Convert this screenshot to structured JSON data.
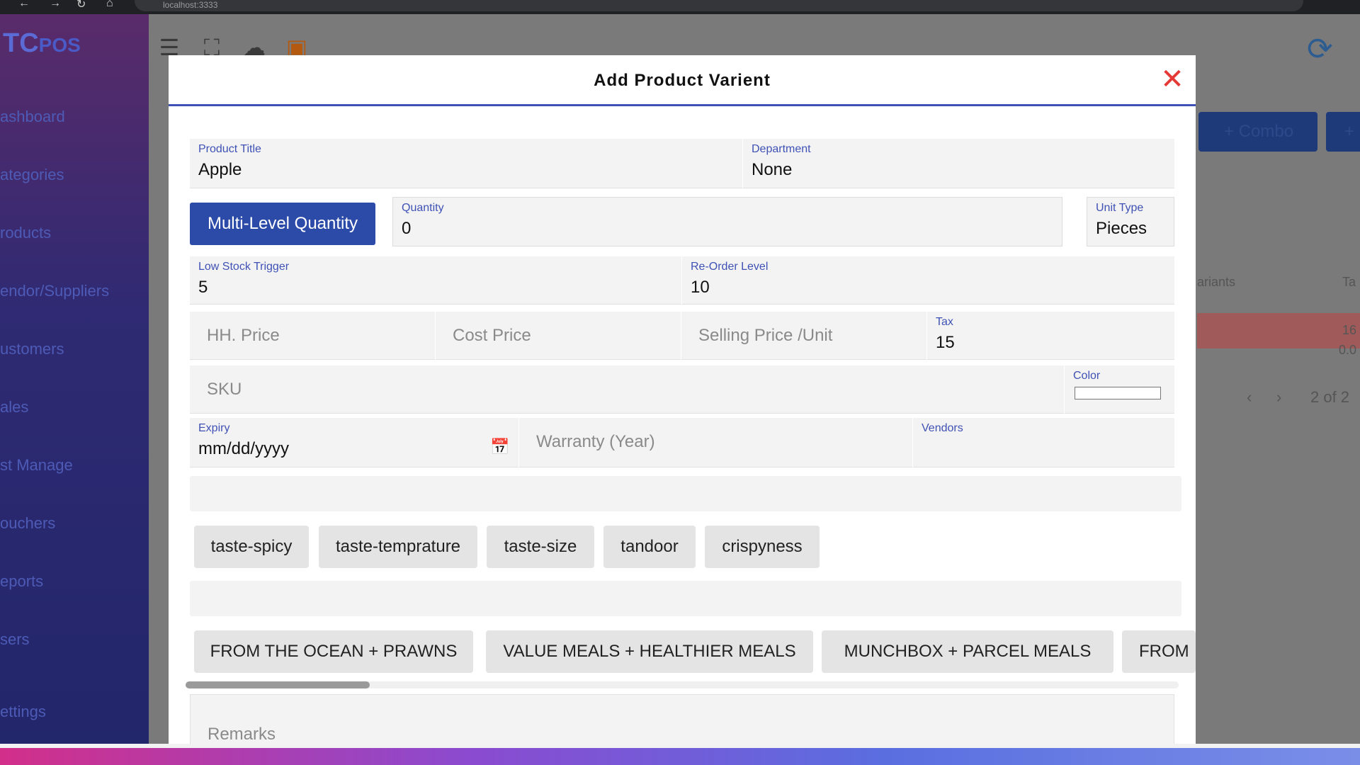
{
  "browser": {
    "url": "localhost:3333",
    "nav_back": "←",
    "nav_forward": "→",
    "nav_reload": "↻",
    "nav_home": "⌂"
  },
  "background": {
    "logo_main": "TC",
    "logo_sub": "POS",
    "sidebar_items": [
      "ashboard",
      "ategories",
      "roducts",
      "endor/Suppliers",
      "ustomers",
      "ales",
      "st Manage",
      "ouchers",
      "eports",
      "sers",
      "ettings"
    ],
    "combo_button": "+ Combo",
    "plus_button": "+",
    "variants_header": "ariants",
    "tax_header": "Ta",
    "row1_value": "16",
    "row2_value": "0.0",
    "pager_text": "2 of 2"
  },
  "modal": {
    "title": "Add Product Varient",
    "product_title_label": "Product Title",
    "product_title_value": "Apple",
    "department_label": "Department",
    "department_value": "None",
    "mlq_button": "Multi-Level Quantity",
    "quantity_label": "Quantity",
    "quantity_value": "0",
    "unit_type_label": "Unit Type",
    "unit_type_value": "Pieces",
    "low_stock_label": "Low Stock Trigger",
    "low_stock_value": "5",
    "reorder_label": "Re-Order Level",
    "reorder_value": "10",
    "hh_price_placeholder": "HH. Price",
    "cost_price_placeholder": "Cost Price",
    "selling_price_placeholder": "Selling Price /Unit",
    "tax_label": "Tax",
    "tax_value": "15",
    "sku_placeholder": "SKU",
    "color_label": "Color",
    "expiry_label": "Expiry",
    "expiry_value": "mm/dd/yyyy",
    "warranty_placeholder": "Warranty (Year)",
    "vendors_label": "Vendors",
    "tag_chips": [
      "taste-spicy",
      "taste-temprature",
      "taste-size",
      "tandoor",
      "crispyness"
    ],
    "category_chips": [
      "FROM THE OCEAN + PRAWNS",
      "VALUE MEALS + HEALTHIER MEALS",
      "MUNCHBOX + PARCEL MEALS",
      "FROM"
    ],
    "remarks_placeholder": "Remarks"
  },
  "colors": {
    "accent": "#3f51b5",
    "button": "#2c4aa8",
    "close": "#e53935"
  }
}
